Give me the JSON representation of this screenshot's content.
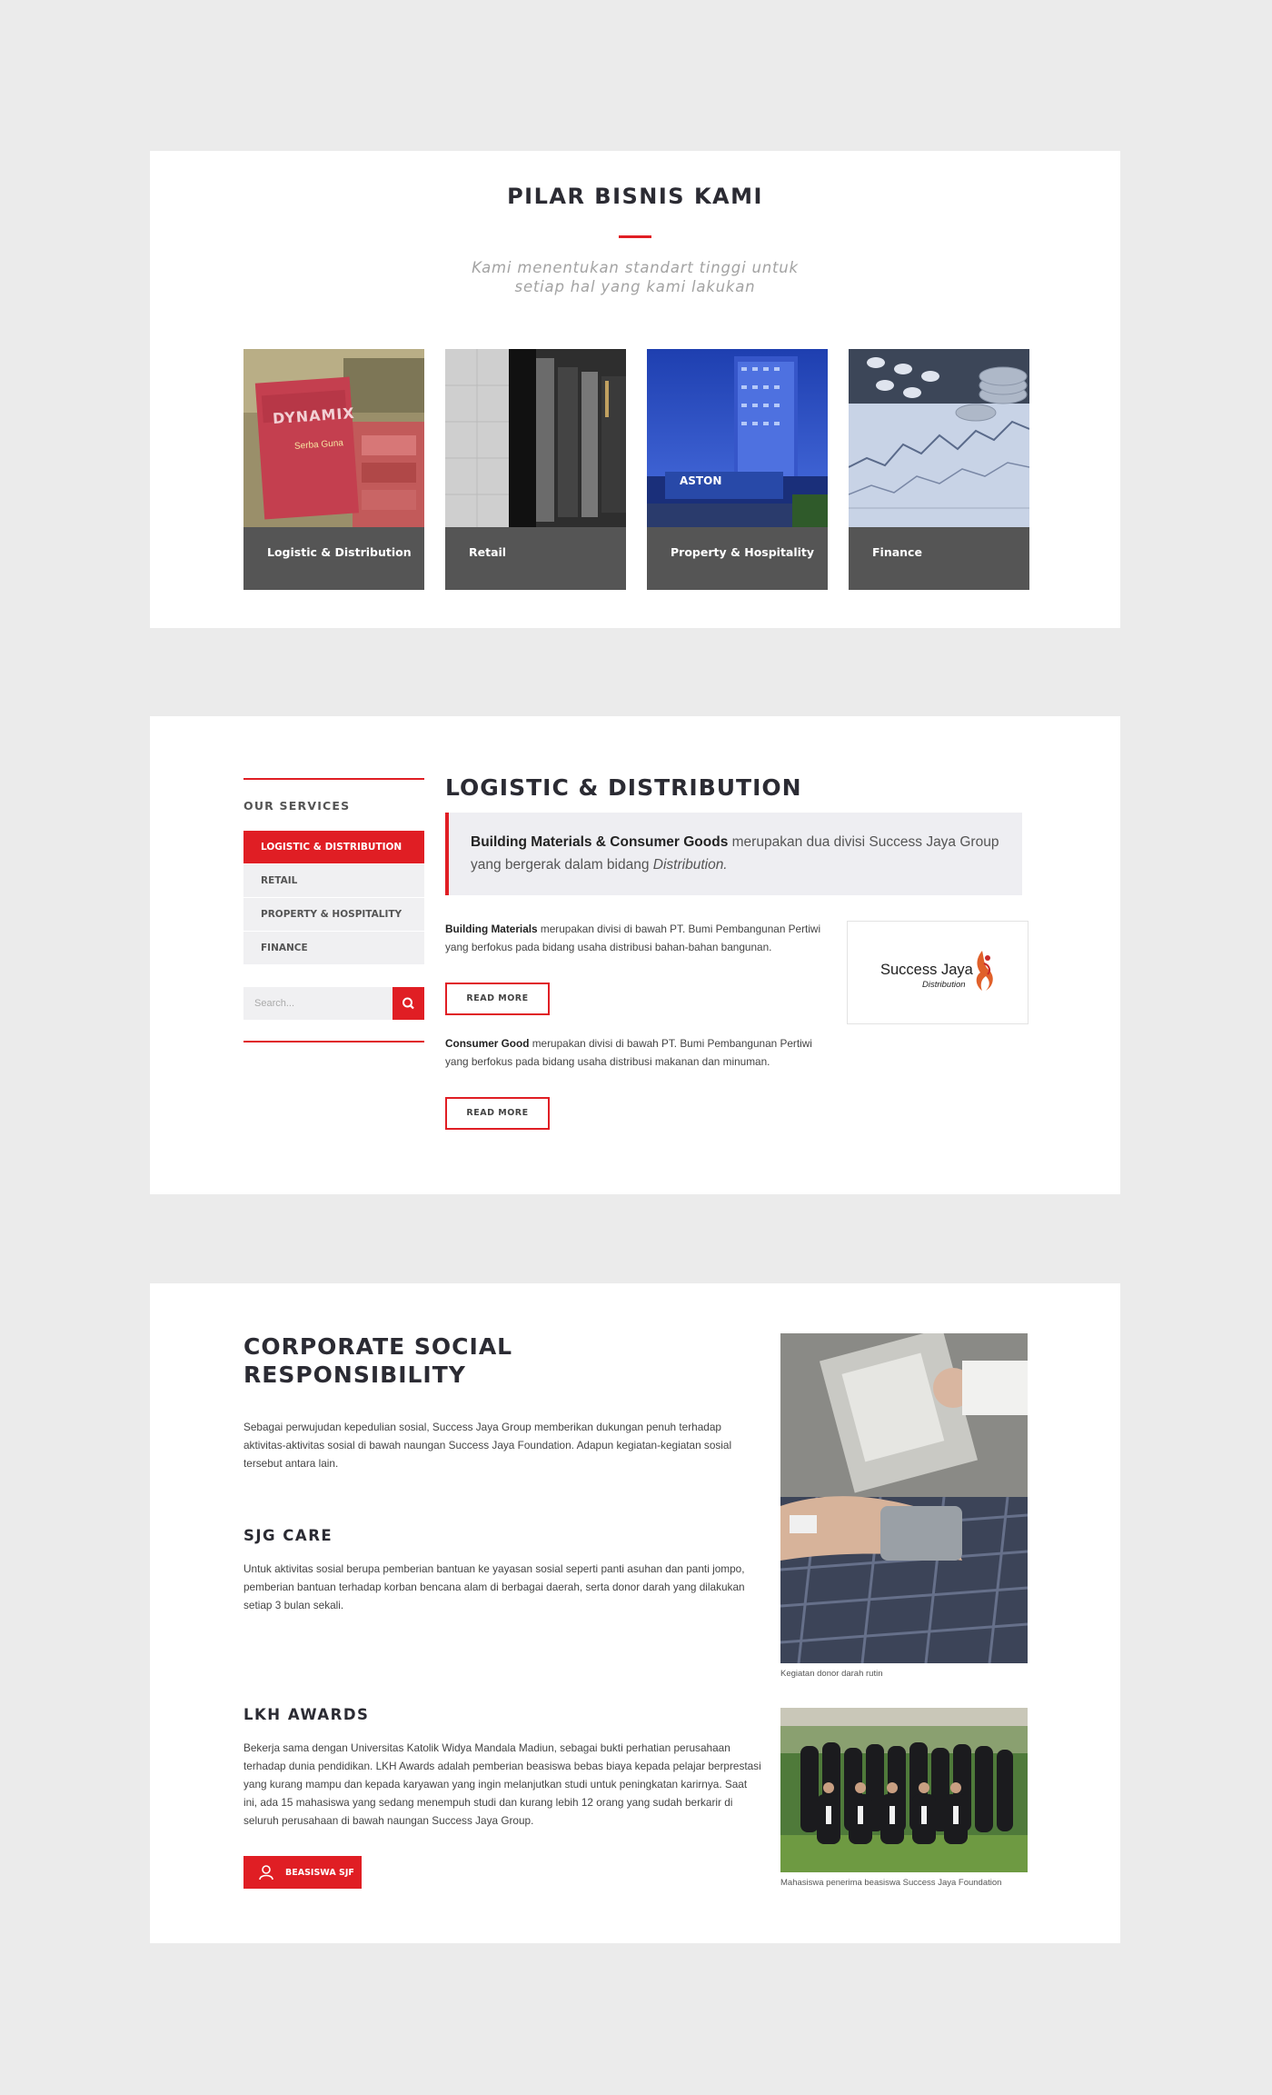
{
  "pillars": {
    "title": "PILAR BISNIS KAMI",
    "subtitle": "Kami menentukan standart tinggi untuk setiap hal yang kami lakukan",
    "items": [
      {
        "label": "Logistic & Distribution",
        "image_brand": "DYNAMIX",
        "image_sub": "Serba Guna"
      },
      {
        "label": "Retail"
      },
      {
        "label": "Property & Hospitality",
        "image_sign": "ASTON"
      },
      {
        "label": "Finance"
      }
    ]
  },
  "services": {
    "sidebar_heading": "OUR SERVICES",
    "items": [
      {
        "label": "LOGISTIC & DISTRIBUTION",
        "active": true
      },
      {
        "label": "RETAIL",
        "active": false
      },
      {
        "label": "PROPERTY & HOSPITALITY",
        "active": false
      },
      {
        "label": "FINANCE",
        "active": false
      }
    ],
    "search_placeholder": "Search...",
    "title": "LOGISTIC & DISTRIBUTION",
    "quote": {
      "bold": "Building Materials & Consumer Goods",
      "text": " merupakan dua divisi Success Jaya Group yang bergerak dalam bidang ",
      "italic": "Distribution."
    },
    "blocks": [
      {
        "bold": "Building Materials",
        "text": " merupakan divisi di bawah PT. Bumi Pembangunan Pertiwi yang berfokus pada bidang usaha distribusi bahan-bahan bangunan.",
        "button": "READ MORE"
      },
      {
        "bold": "Consumer Good",
        "text": " merupakan divisi di bawah PT. Bumi Pembangunan Pertiwi yang berfokus pada bidang usaha distribusi makanan dan minuman.",
        "button": "READ MORE"
      }
    ],
    "logo": {
      "name": "Success Jaya",
      "sub": "Distribution"
    }
  },
  "csr": {
    "title": "CORPORATE SOCIAL RESPONSIBILITY",
    "intro": "Sebagai perwujudan kepedulian sosial, Success Jaya Group memberikan dukungan penuh terhadap aktivitas-aktivitas sosial di bawah naungan Success Jaya Foundation. Adapun kegiatan-kegiatan sosial tersebut antara lain.",
    "care_title": "SJG CARE",
    "care_text": "Untuk aktivitas sosial berupa pemberian bantuan ke yayasan sosial seperti panti asuhan dan panti jompo, pemberian bantuan terhadap korban bencana alam di berbagai daerah, serta donor darah yang dilakukan setiap 3 bulan sekali.",
    "awards_title": "LKH AWARDS",
    "awards_text": "Bekerja sama dengan Universitas Katolik Widya Mandala Madiun, sebagai bukti perhatian perusahaan terhadap dunia pendidikan. LKH Awards adalah pemberian beasiswa bebas biaya kepada pelajar berprestasi yang kurang mampu dan kepada karyawan yang ingin melanjutkan studi untuk peningkatan karirnya. Saat ini, ada 15 mahasiswa yang sedang menempuh studi dan kurang lebih 12 orang yang sudah berkarir di seluruh perusahaan di bawah naungan Success Jaya Group.",
    "button": "BEASISWA SJF",
    "photo1_caption": "Kegiatan donor darah rutin",
    "photo2_caption": "Mahasiswa penerima beasiswa Success Jaya Foundation"
  },
  "colors": {
    "accent": "#e01e24",
    "tile": "#555555",
    "page_bg": "#ebebeb"
  }
}
